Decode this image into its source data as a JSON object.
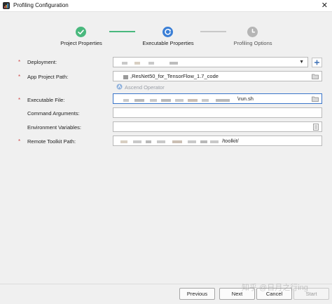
{
  "window": {
    "title": "Profiling Configuration",
    "close_glyph": "✕"
  },
  "wizard": {
    "steps": [
      {
        "label": "Project Properties",
        "state": "done",
        "icon": "check-icon",
        "color": "#49b87d"
      },
      {
        "label": "Executable Properties",
        "state": "current",
        "icon": "progress-icon",
        "color": "#3b7fd6"
      },
      {
        "label": "Profiling Options",
        "state": "pending",
        "icon": "clock-icon",
        "color": "#b5b5b5"
      }
    ],
    "connector_done_color": "#49b87d",
    "connector_pending_color": "#c8c8c8"
  },
  "form": {
    "required_mark": "*",
    "deployment": {
      "label": "Deployment:"
    },
    "app_project_path": {
      "label": "App Project Path:",
      "value": ",ResNet50_for_TensorFlow_1.7_code"
    },
    "ascend_operator": {
      "label": "Ascend Operator"
    },
    "executable_file": {
      "label": "Executable File:",
      "value": "\\run.sh"
    },
    "command_arguments": {
      "label": "Command Arguments:",
      "value": ""
    },
    "environment_variables": {
      "label": "Environment Variables:",
      "value": ""
    },
    "remote_toolkit_path": {
      "label": "Remote Toolkit Path:",
      "value": "/toolkit/"
    }
  },
  "buttons": {
    "previous": "Previous",
    "next": "Next",
    "cancel": "Cancel",
    "start": "Start"
  },
  "watermark": "知乎 @日月之行ing",
  "colors": {
    "required": "#d04848",
    "focus_border": "#3a75c9",
    "link_disabled": "#9a9ea6"
  }
}
